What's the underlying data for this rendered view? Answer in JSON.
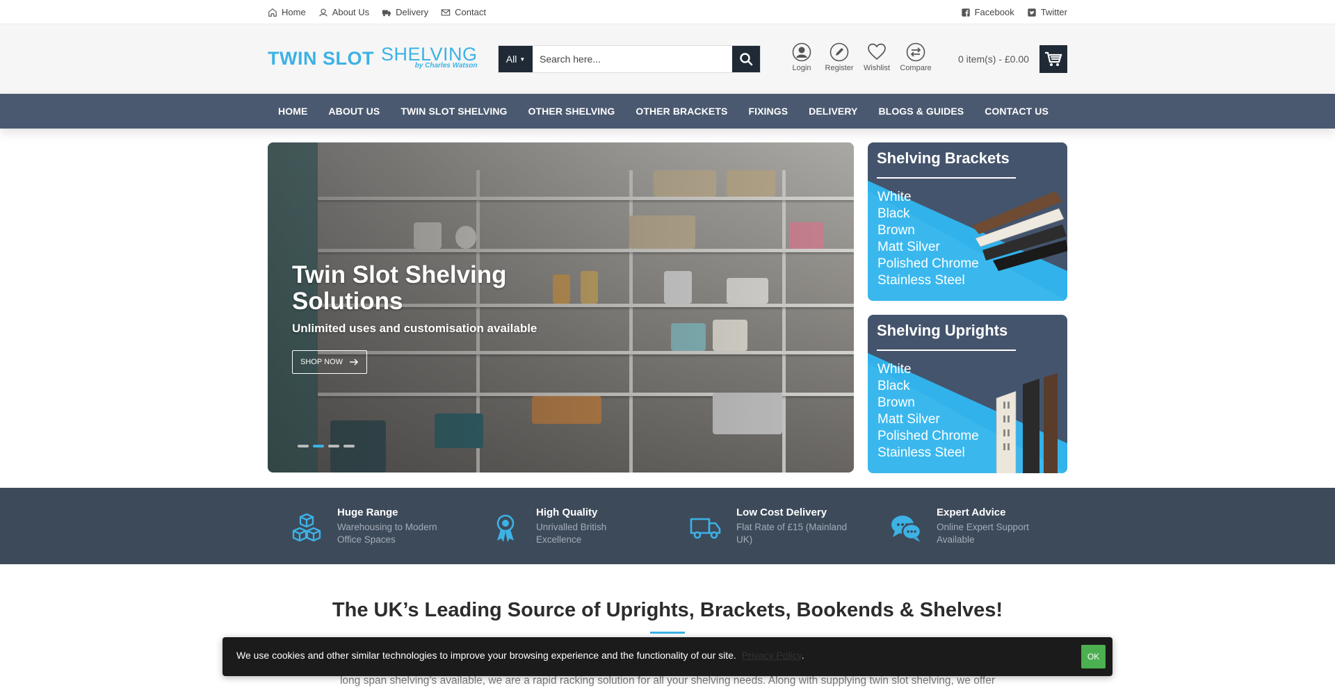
{
  "topbar": {
    "links": [
      {
        "label": "Home",
        "icon": "home-icon"
      },
      {
        "label": "About Us",
        "icon": "user-icon"
      },
      {
        "label": "Delivery",
        "icon": "truck-icon"
      },
      {
        "label": "Contact",
        "icon": "mail-icon"
      }
    ],
    "social": [
      {
        "label": "Facebook",
        "icon": "facebook-icon"
      },
      {
        "label": "Twitter",
        "icon": "twitter-icon"
      }
    ]
  },
  "logo": {
    "main": "TWIN SLOT",
    "sub": "SHELVING",
    "by": "by Charles Watson"
  },
  "search": {
    "category": "All",
    "placeholder": "Search here..."
  },
  "header_icons": [
    {
      "label": "Login",
      "icon": "user-circle-icon"
    },
    {
      "label": "Register",
      "icon": "pencil-circle-icon"
    },
    {
      "label": "Wishlist",
      "icon": "heart-icon"
    },
    {
      "label": "Compare",
      "icon": "compare-icon"
    }
  ],
  "cart": {
    "text": "0 item(s) - £0.00"
  },
  "nav": [
    "HOME",
    "ABOUT US",
    "TWIN SLOT SHELVING",
    "OTHER SHELVING",
    "OTHER BRACKETS",
    "FIXINGS",
    "DELIVERY",
    "BLOGS & GUIDES",
    "CONTACT US"
  ],
  "hero": {
    "title": "Twin Slot Shelving Solutions",
    "subtitle": "Unlimited uses and customisation available",
    "button": "SHOP NOW",
    "slides": 4,
    "active_slide": 2
  },
  "banners": [
    {
      "title": "Shelving Brackets",
      "items": [
        "White",
        "Black",
        "Brown",
        "Matt Silver",
        "Polished Chrome",
        "Stainless Steel"
      ]
    },
    {
      "title": "Shelving Uprights",
      "items": [
        "White",
        "Black",
        "Brown",
        "Matt Silver",
        "Polished Chrome",
        "Stainless Steel"
      ]
    }
  ],
  "features": [
    {
      "title": "Huge Range",
      "desc": "Warehousing to Modern Office Spaces",
      "icon": "cubes-icon"
    },
    {
      "title": "High Quality",
      "desc": "Unrivalled British Excellence",
      "icon": "award-icon"
    },
    {
      "title": "Low Cost Delivery",
      "desc": "Flat Rate of £15 (Mainland UK)",
      "icon": "truck-icon"
    },
    {
      "title": "Expert Advice",
      "desc": "Online Expert Support Available",
      "icon": "chat-icon"
    }
  ],
  "main": {
    "title": "The UK’s Leading Source of Uprights, Brackets, Bookends & Shelves!",
    "body": "long span shelving’s available, we are a rapid racking solution for all your shelving needs. Along with supplying twin slot shelving, we offer"
  },
  "cookie": {
    "text": "We use cookies and other similar technologies to improve your browsing experience and the functionality of our site.",
    "link": "Privacy Policy",
    "ok": "OK"
  },
  "colors": {
    "accent": "#3cb2e5",
    "dark": "#202a36",
    "nav": "#4a5970",
    "band": "#3d4a5a",
    "ok": "#4caf50"
  }
}
